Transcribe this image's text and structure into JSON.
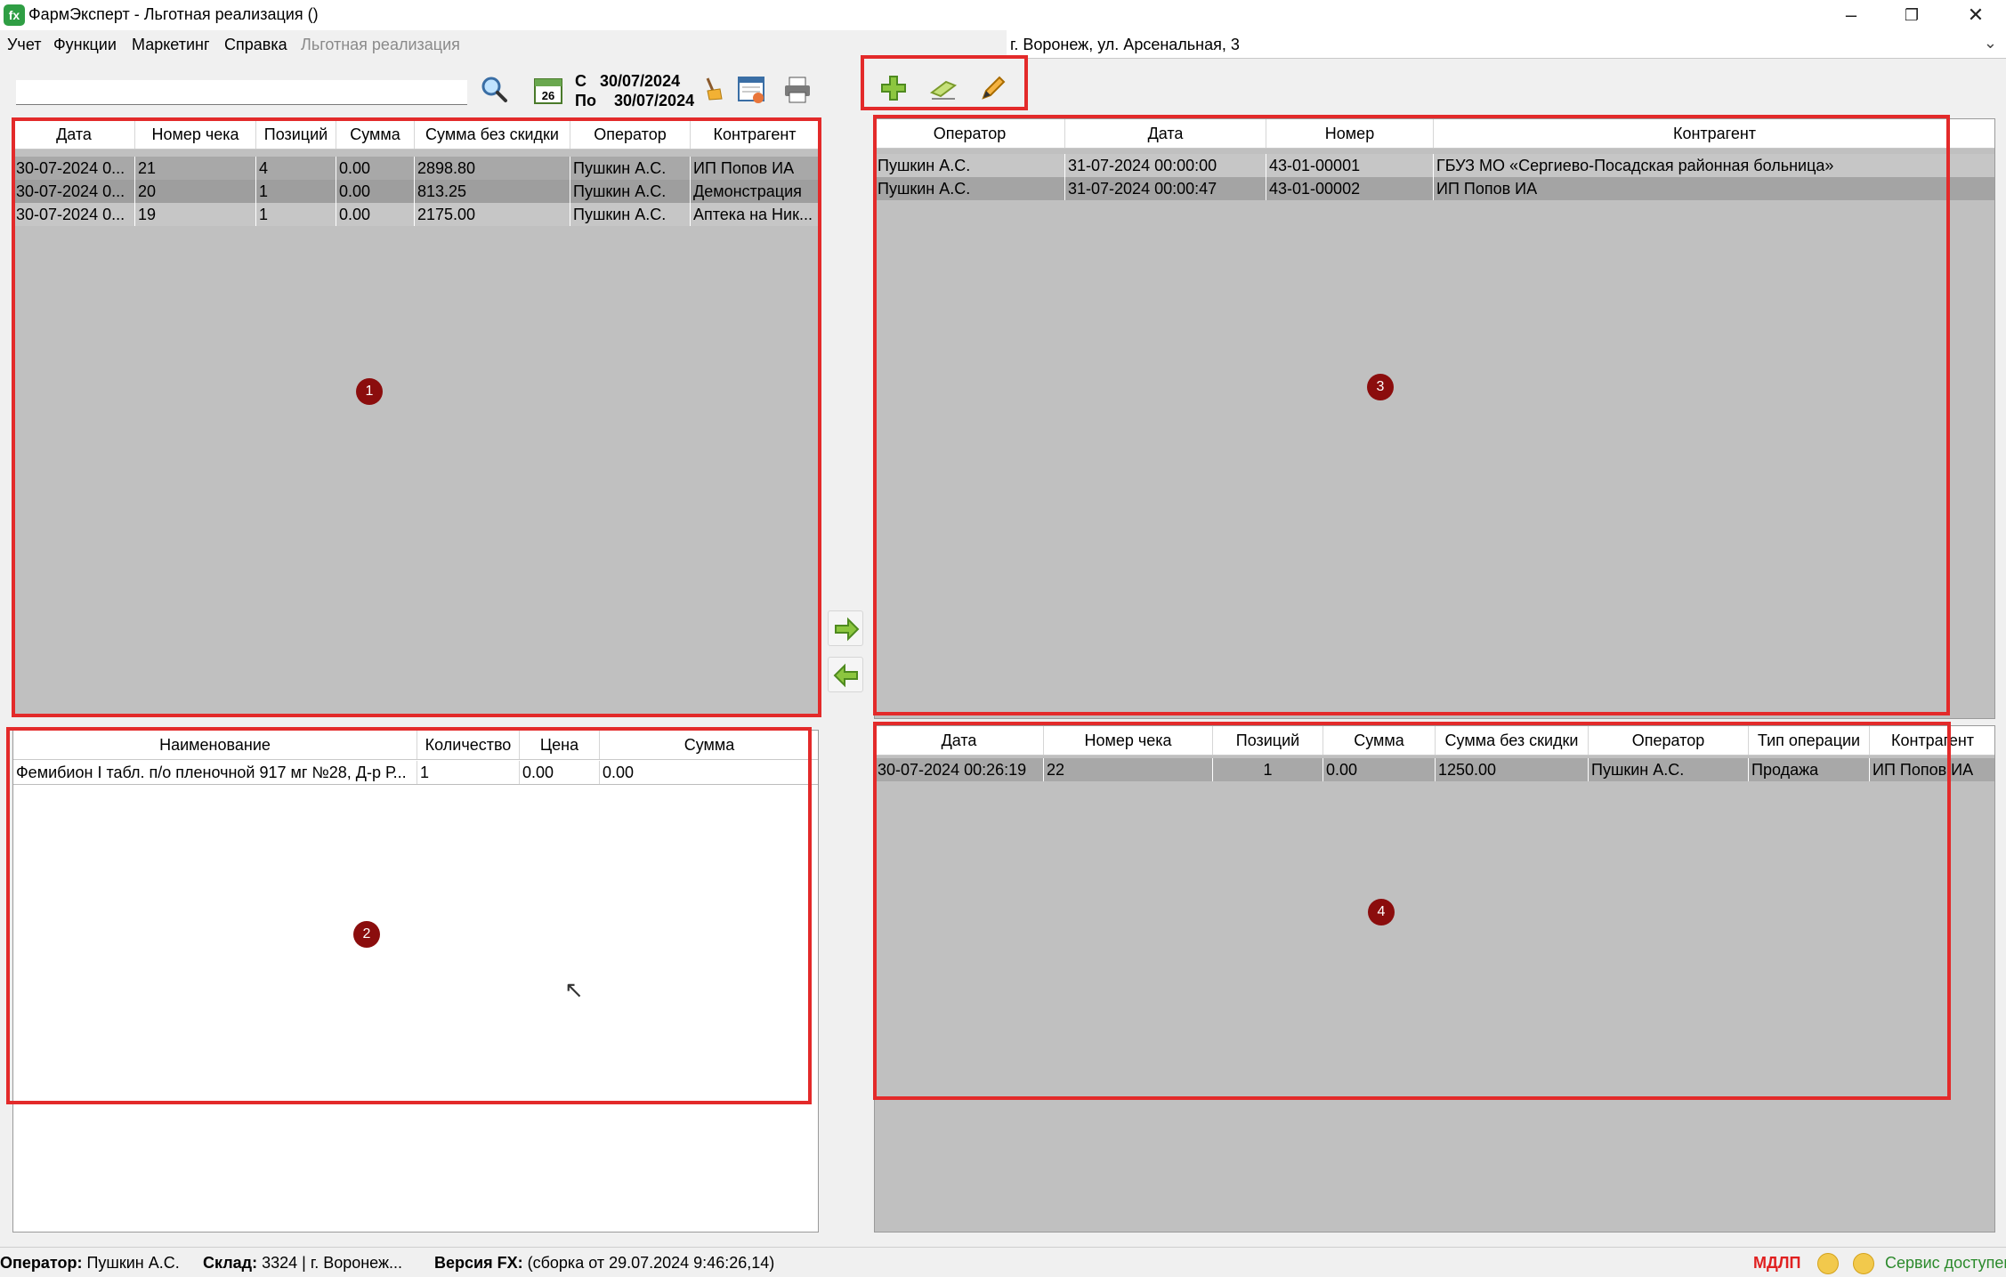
{
  "window": {
    "title": "ФармЭксперт - Льготная реализация ()",
    "app_icon": "fx-logo"
  },
  "menu": {
    "items": [
      "Учет",
      "Функции",
      "Маркетинг",
      "Справка"
    ],
    "disabled_item": "Льготная реализация"
  },
  "location": {
    "value": "г. Воронеж, ул. Арсенальная, 3"
  },
  "toolbar": {
    "search_placeholder": "",
    "calendar_day": "26",
    "date_from_label": "С",
    "date_from": "30/07/2024",
    "date_to_label": "По",
    "date_to": "30/07/2024"
  },
  "receipts_grid": {
    "columns": [
      "Дата",
      "Номер чека",
      "Позиций",
      "Сумма",
      "Сумма без скидки",
      "Оператор",
      "Контрагент"
    ],
    "rows": [
      [
        "30-07-2024 0...",
        "21",
        "4",
        "0.00",
        "2898.80",
        "Пушкин А.С.",
        "ИП Попов ИА"
      ],
      [
        "30-07-2024 0...",
        "20",
        "1",
        "0.00",
        "813.25",
        "Пушкин А.С.",
        "Демонстрация"
      ],
      [
        "30-07-2024 0...",
        "19",
        "1",
        "0.00",
        "2175.00",
        "Пушкин А.С.",
        "Аптека на Ник..."
      ]
    ]
  },
  "items_grid": {
    "columns": [
      "Наименование",
      "Количество",
      "Цена",
      "Сумма"
    ],
    "rows": [
      [
        "Фемибион I табл. п/о пленочной 917 мг №28, Д-р Р...",
        "1",
        "0.00",
        "0.00"
      ]
    ]
  },
  "registry_grid": {
    "columns": [
      "Оператор",
      "Дата",
      "Номер",
      "Контрагент"
    ],
    "rows": [
      [
        "Пушкин А.С.",
        "31-07-2024 00:00:00",
        "43-01-00001",
        "ГБУЗ МО «Сергиево-Посадская районная больница»"
      ],
      [
        "Пушкин А.С.",
        "31-07-2024 00:00:47",
        "43-01-00002",
        "ИП Попов ИА"
      ]
    ]
  },
  "registry_receipts_grid": {
    "columns": [
      "Дата",
      "Номер чека",
      "Позиций",
      "Сумма",
      "Сумма без скидки",
      "Оператор",
      "Тип операции",
      "Контрагент"
    ],
    "rows": [
      [
        "30-07-2024 00:26:19",
        "22",
        "1",
        "0.00",
        "1250.00",
        "Пушкин А.С.",
        "Продажа",
        "ИП Попов ИА"
      ]
    ]
  },
  "markers": [
    "1",
    "2",
    "3",
    "4"
  ],
  "status": {
    "operator_label": "Оператор:",
    "operator": "Пушкин А.С.",
    "store_label": "Склад:",
    "store": "3324 | г. Воронеж...",
    "version_label": "Версия FX:",
    "version": "(сборка от 29.07.2024 9:46:26,14)",
    "mdlp": "МДЛП",
    "service": "Сервис доступен"
  },
  "colors": {
    "highlight": "#e32a2a",
    "marker": "#8b0d0d",
    "grid_bg": "#c0c0c0",
    "selected_row": "#a8a8a8"
  }
}
